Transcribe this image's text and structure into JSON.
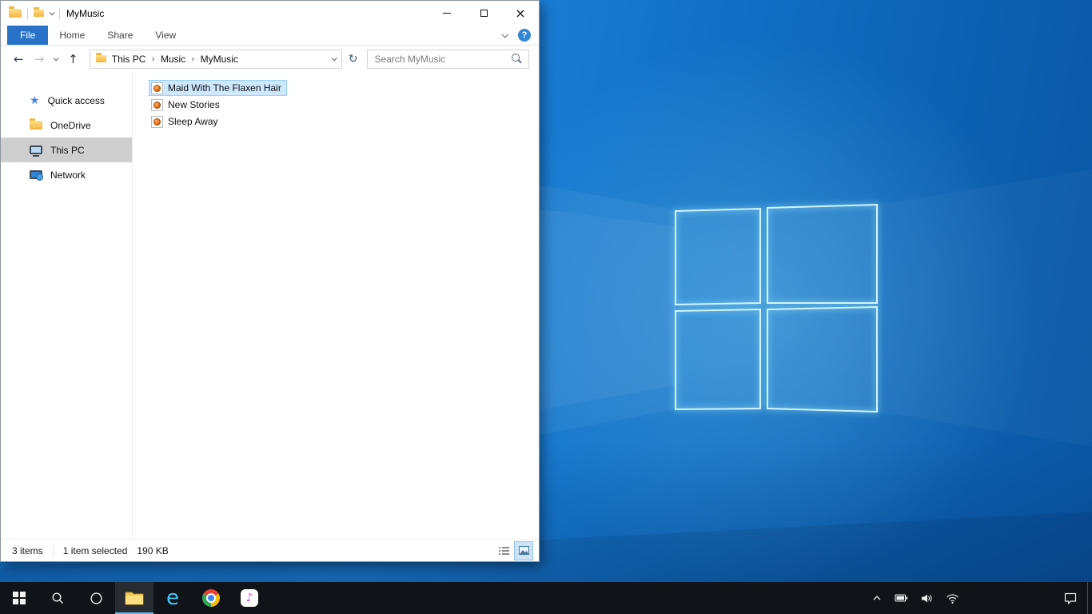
{
  "colors": {
    "accent_blue": "#2873c8",
    "file_selection_fill": "#cde8ff",
    "file_selection_border": "#99d1ff",
    "sidebar_selected_gray": "#cfcfcf",
    "taskbar_bg": "#101418",
    "desktop_blue": "#1373cb",
    "logo_glow_cyan": "#8ee4ff",
    "folder_yellow": "#f3b53f"
  },
  "icons": {
    "quick_access_star": "★",
    "back": "←",
    "forward": "→",
    "up": "↑",
    "refresh": "↻",
    "breadcrumb_separator": "›",
    "help": "?",
    "close": "×",
    "ie_e": "e",
    "itunes_note": "♪"
  },
  "explorer": {
    "window_title": "MyMusic",
    "ribbon": {
      "tabs": [
        {
          "label": "File"
        },
        {
          "label": "Home"
        },
        {
          "label": "Share"
        },
        {
          "label": "View"
        }
      ]
    },
    "address_bar": {
      "crumbs": [
        "This PC",
        "Music",
        "MyMusic"
      ]
    },
    "search": {
      "placeholder": "Search MyMusic"
    },
    "sidebar": {
      "items": [
        {
          "label": "Quick access",
          "icon": "star-icon",
          "selected": false
        },
        {
          "label": "OneDrive",
          "icon": "folder-icon",
          "selected": false
        },
        {
          "label": "This PC",
          "icon": "computer-icon",
          "selected": true
        },
        {
          "label": "Network",
          "icon": "network-icon",
          "selected": false
        }
      ]
    },
    "files": [
      {
        "name": "Maid With The Flaxen Hair",
        "icon": "media-file-icon",
        "selected": true
      },
      {
        "name": "New Stories",
        "icon": "media-file-icon",
        "selected": false
      },
      {
        "name": "Sleep Away",
        "icon": "media-file-icon",
        "selected": false
      }
    ],
    "status_bar": {
      "item_count": "3 items",
      "selection": "1 item selected",
      "selection_size": "190 KB"
    }
  },
  "taskbar": {
    "buttons": [
      "start",
      "search",
      "cortana",
      "file-explorer",
      "internet-explorer",
      "chrome",
      "itunes"
    ],
    "active_button": "file-explorer",
    "tray": [
      "hidden-icons-chevron",
      "battery",
      "volume",
      "wifi"
    ],
    "far_right": [
      "action-center",
      "show-desktop"
    ]
  }
}
